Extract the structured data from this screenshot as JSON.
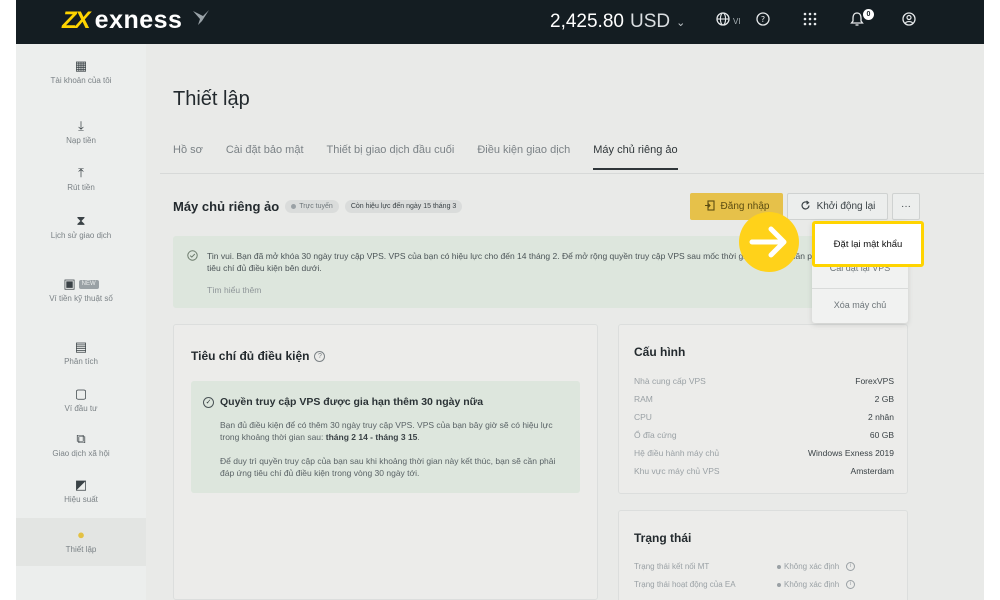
{
  "topbar": {
    "logo_mark": "ZX",
    "logo_text": "exness",
    "balance": "2,425.80",
    "currency": "USD",
    "lang": "VI",
    "notification_count": "0"
  },
  "sidebar": {
    "items": [
      {
        "label": "Tài khoản của tôi",
        "icon": "grid-icon",
        "glyph": "▦"
      },
      {
        "label": "Nạp tiền",
        "icon": "deposit-icon",
        "glyph": "⤓"
      },
      {
        "label": "Rút tiền",
        "icon": "withdraw-icon",
        "glyph": "⤒"
      },
      {
        "label": "Lịch sử giao dịch",
        "icon": "hourglass-icon",
        "glyph": "⧗"
      },
      {
        "label": "Ví tiền kỹ thuật số",
        "icon": "wallet-icon",
        "glyph": "▣",
        "badge": "NEW"
      },
      {
        "label": "Phân tích",
        "icon": "chat-icon",
        "glyph": "▤"
      },
      {
        "label": "Ví đầu tư",
        "icon": "portfolio-icon",
        "glyph": "▢"
      },
      {
        "label": "Giao dịch xã hội",
        "icon": "social-icon",
        "glyph": "⧉"
      },
      {
        "label": "Hiệu suất",
        "icon": "performance-icon",
        "glyph": "◩"
      },
      {
        "label": "Thiết lập",
        "icon": "settings-icon",
        "glyph": "●"
      }
    ]
  },
  "main": {
    "title": "Thiết lập",
    "tabs": [
      {
        "label": "Hồ sơ"
      },
      {
        "label": "Cài đặt bảo mật"
      },
      {
        "label": "Thiết bị giao dịch đầu cuối"
      },
      {
        "label": "Điều kiện giao dịch"
      },
      {
        "label": "Máy chủ riêng ảo"
      }
    ],
    "section_title": "Máy chủ riêng ảo",
    "status_pill": "Trực tuyến",
    "validity_pill": "Còn hiệu lực đến ngày 15 tháng 3",
    "login_button": "Đăng nhập",
    "restart_button": "Khởi động lại",
    "more_button": "···",
    "banner_text": "Tin vui. Bạn đã mở khóa 30 ngày truy cập VPS. VPS của bạn có hiệu lực cho đến 14 tháng 2. Để mở rộng quyền truy cập VPS sau mốc thời gian này, bạn cần phải đáp ứng các tiêu chí đủ điều kiện bên dưới.",
    "banner_link": "Tìm hiểu thêm",
    "criteria": {
      "title": "Tiêu chí đủ điều kiện",
      "box_heading": "Quyền truy cập VPS được gia hạn thêm 30 ngày nữa",
      "p1_before": "Bạn đủ điều kiện để có thêm 30 ngày truy cập VPS. VPS của bạn bây giờ sẽ có hiệu lực trong khoảng thời gian sau: ",
      "p1_bold": "tháng 2 14 - tháng 3 15",
      "p1_after": ".",
      "p2": "Để duy trì quyền truy cập của bạn sau khi khoảng thời gian này kết thúc, bạn sẽ cần phải đáp ứng tiêu chí đủ điều kiện trong vòng 30 ngày tới."
    },
    "config": {
      "title": "Cấu hình",
      "rows": [
        {
          "k": "Nhà cung cấp VPS",
          "v": "ForexVPS"
        },
        {
          "k": "RAM",
          "v": "2 GB"
        },
        {
          "k": "CPU",
          "v": "2 nhân"
        },
        {
          "k": "Ổ đĩa cứng",
          "v": "60 GB"
        },
        {
          "k": "Hệ điều hành máy chủ",
          "v": "Windows Exness 2019"
        },
        {
          "k": "Khu vực máy chủ VPS",
          "v": "Amsterdam"
        }
      ]
    },
    "status": {
      "title": "Trạng thái",
      "rows": [
        {
          "k": "Trạng thái kết nối MT",
          "v": "Không xác định"
        },
        {
          "k": "Trạng thái hoạt động của EA",
          "v": "Không xác định"
        }
      ]
    }
  },
  "dropdown": {
    "items": [
      {
        "label": "Đặt lại mật khẩu"
      },
      {
        "label": "Cài đặt lại VPS"
      },
      {
        "label": "Xóa máy chủ"
      }
    ]
  },
  "colors": {
    "brand_yellow": "#ffd400",
    "topbar_bg": "#141d22",
    "login_button": "#e6c14a"
  }
}
